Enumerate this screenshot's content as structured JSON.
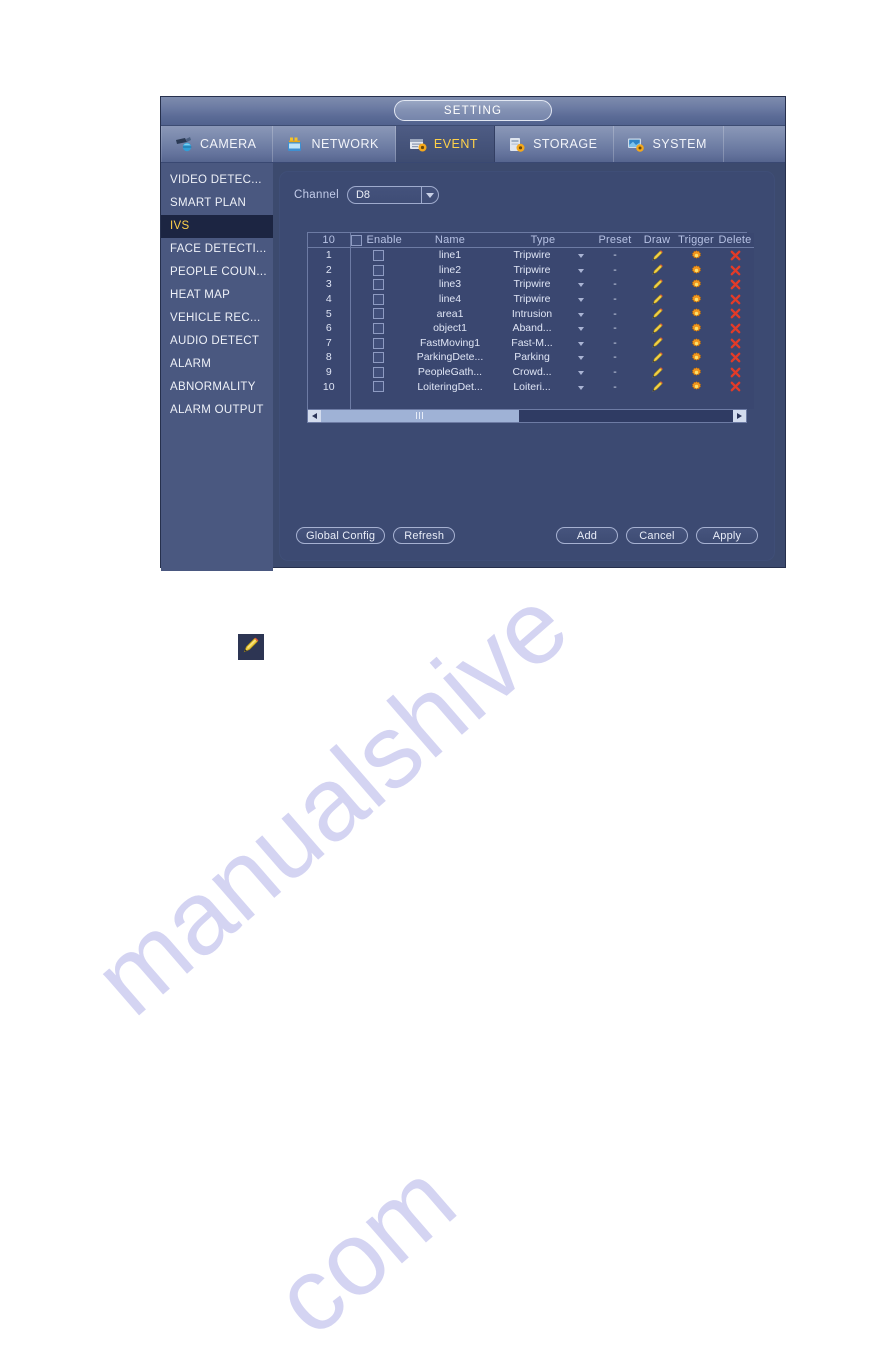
{
  "window": {
    "title": "SETTING"
  },
  "tabs": [
    {
      "label": "CAMERA",
      "icon": "camera-icon",
      "active": false
    },
    {
      "label": "NETWORK",
      "icon": "network-icon",
      "active": false
    },
    {
      "label": "EVENT",
      "icon": "event-icon",
      "active": true
    },
    {
      "label": "STORAGE",
      "icon": "storage-icon",
      "active": false
    },
    {
      "label": "SYSTEM",
      "icon": "system-icon",
      "active": false
    }
  ],
  "sidebar": {
    "items": [
      {
        "label": "VIDEO DETEC...",
        "active": false
      },
      {
        "label": "SMART PLAN",
        "active": false
      },
      {
        "label": "IVS",
        "active": true
      },
      {
        "label": "FACE DETECTI...",
        "active": false
      },
      {
        "label": "PEOPLE COUN...",
        "active": false
      },
      {
        "label": "HEAT MAP",
        "active": false
      },
      {
        "label": "VEHICLE REC...",
        "active": false
      },
      {
        "label": "AUDIO DETECT",
        "active": false
      },
      {
        "label": "ALARM",
        "active": false
      },
      {
        "label": "ABNORMALITY",
        "active": false
      },
      {
        "label": "ALARM OUTPUT",
        "active": false
      }
    ]
  },
  "form": {
    "channel_label": "Channel",
    "channel_value": "D8"
  },
  "table": {
    "headers": {
      "count": "10",
      "enable": "Enable",
      "name": "Name",
      "type": "Type",
      "preset": "Preset",
      "draw": "Draw",
      "trigger": "Trigger",
      "delete": "Delete"
    },
    "rows": [
      {
        "no": "1",
        "enabled": false,
        "name": "line1",
        "type": "Tripwire",
        "preset": "-"
      },
      {
        "no": "2",
        "enabled": false,
        "name": "line2",
        "type": "Tripwire",
        "preset": "-"
      },
      {
        "no": "3",
        "enabled": false,
        "name": "line3",
        "type": "Tripwire",
        "preset": "-"
      },
      {
        "no": "4",
        "enabled": false,
        "name": "line4",
        "type": "Tripwire",
        "preset": "-"
      },
      {
        "no": "5",
        "enabled": false,
        "name": "area1",
        "type": "Intrusion",
        "preset": "-"
      },
      {
        "no": "6",
        "enabled": false,
        "name": "object1",
        "type": "Aband...",
        "preset": "-"
      },
      {
        "no": "7",
        "enabled": false,
        "name": "FastMoving1",
        "type": "Fast-M...",
        "preset": "-"
      },
      {
        "no": "8",
        "enabled": false,
        "name": "ParkingDete...",
        "type": "Parking",
        "preset": "-"
      },
      {
        "no": "9",
        "enabled": false,
        "name": "PeopleGath...",
        "type": "Crowd...",
        "preset": "-"
      },
      {
        "no": "10",
        "enabled": false,
        "name": "LoiteringDet...",
        "type": "Loiteri...",
        "preset": "-"
      }
    ]
  },
  "buttons": {
    "global_config": "Global Config",
    "refresh": "Refresh",
    "add": "Add",
    "cancel": "Cancel",
    "apply": "Apply"
  },
  "watermark": {
    "line1": "manualshive",
    "line2": "com"
  },
  "colors": {
    "accent_yellow": "#ffd24a",
    "panel_blue": "#3c4a72",
    "sidebar_blue": "#4a5880",
    "active_item": "#1c2542",
    "pencil_yellow": "#f2d24a",
    "gear_orange": "#f0941e",
    "delete_red": "#e23b28"
  }
}
